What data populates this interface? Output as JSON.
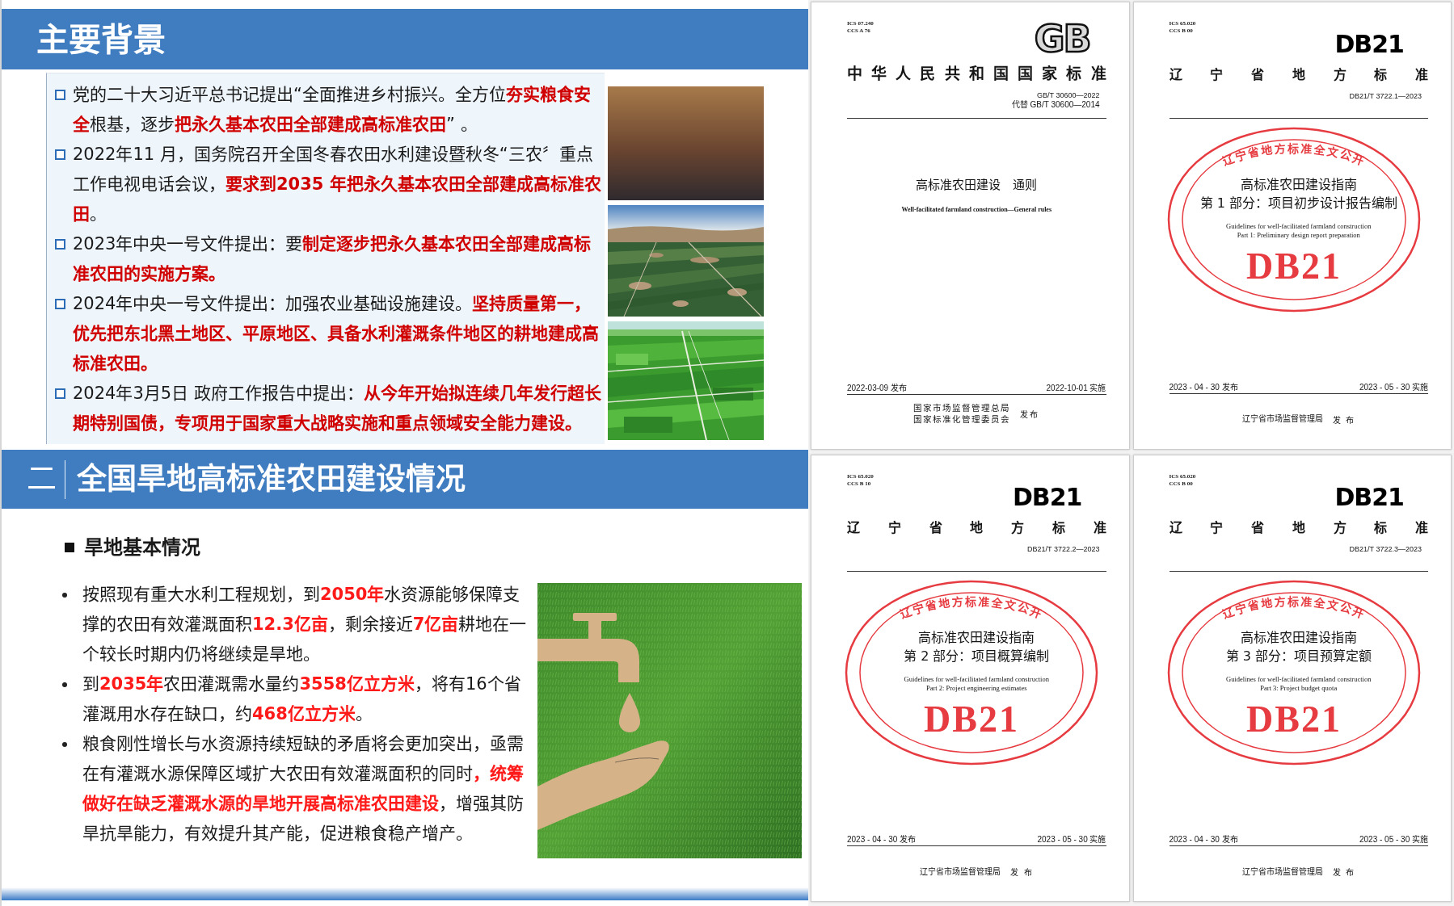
{
  "slides": [
    {
      "kind": "background",
      "title": "主要背景",
      "bullets": [
        "党的二十大习近平总书记提出“全面推进乡村振兴。全方位**夯实粮食安全**根基，逐步**把永久基本农田全部建成高标准农田**” 。",
        "2022年11 月，国务院召开全国冬春农田水利建设暨秋冬“三农〞重点工作电视电话会议，**要求到2035 年把永久基本农田全部建成高标准农田**。",
        "2023年中央一号文件提出：要**制定逐步把永久基本农田全部建成高标准农田的实施方案。**",
        "2024年中央一号文件提出：加强农业基础设施建设。**坚持质量第一，优先把东北黑土地区、平原地区、具备水利灌溉条件地区的耕地建成高标准农田。**",
        "2024年3月5日 政府工作报告中提出：**从今年开始拟连续几年发行超长期特别国债，专项用于国家重大战略实施和重点领域安全能力建设。**"
      ]
    },
    {
      "kind": "dryland",
      "section_number": "二",
      "title": "全国旱地高标准农田建设情况",
      "subheading": "旱地基本情况",
      "bullets": [
        "按照现有重大水利工程规划，到**2050年**水资源能够保障支撑的农田有效灌溉面积**12.3亿亩**，剩余接近**7亿亩**耕地在一个较长时期内仍将继续是旱地。",
        "到**2035年**农田灌溉需水量约**3558亿立方米**，将有16个省灌溉用水存在缺口，约**468亿立方米**。",
        "粮食刚性增长与水资源持续短缺的矛盾将会更加突出，亟需在有灌溉水源保障区域扩大农田有效灌溉面积的同时**，统筹做好在缺乏灌溉水源的旱地开展高标准农田建设**，增强其防旱抗旱能力，有效提升其产能，促进粮食稳产增产。"
      ]
    }
  ],
  "documents": [
    {
      "kind": "national",
      "ics": "ICS 07.240",
      "ccs": "CCS A 76",
      "logo": "GB",
      "issuer_title": "中华人民共和国国家标准",
      "code": "GB/T 30600—2022",
      "replaces": "代替 GB/T 30600—2014",
      "title_lines": [
        "高标准农田建设　通则"
      ],
      "english_lines": [
        "Well-facilitated farmland construction—General rules"
      ],
      "issue_date": "2022-03-09 发布",
      "effective_date": "2022-10-01 实施",
      "issuers": [
        "国家市场监督管理总局",
        "国家标准化管理委员会"
      ],
      "issue_label": "发布"
    },
    {
      "kind": "local",
      "ics": "ICS 65.020",
      "ccs": "CCS B 00",
      "logo": "DB21",
      "issuer_title": "辽宁省地方标准",
      "code": "DB21/T 3722.1—2023",
      "seal": {
        "text": "辽宁省地方标准全文公开",
        "code": "DB21"
      },
      "title_lines": [
        "高标准农田建设指南",
        "第 1 部分：项目初步设计报告编制"
      ],
      "english_lines": [
        "Guidelines for well-facilitated farmland construction",
        "Part 1: Preliminary design report preparation"
      ],
      "issue_date": "2023 - 04 - 30 发布",
      "effective_date": "2023 - 05 - 30 实施",
      "issuers": [
        "辽宁省市场监督管理局"
      ],
      "issue_label": "发 布"
    },
    {
      "kind": "local",
      "ics": "ICS 65.020",
      "ccs": "CCS B 10",
      "logo": "DB21",
      "issuer_title": "辽宁省地方标准",
      "code": "DB21/T 3722.2—2023",
      "seal": {
        "text": "辽宁省地方标准全文公开",
        "code": "DB21"
      },
      "title_lines": [
        "高标准农田建设指南",
        "第 2 部分：项目概算编制"
      ],
      "english_lines": [
        "Guidelines for well-facilitated farmland construction",
        "Part 2: Project engineering estimates"
      ],
      "issue_date": "2023 - 04 - 30 发布",
      "effective_date": "2023 - 05 - 30 实施",
      "issuers": [
        "辽宁省市场监督管理局"
      ],
      "issue_label": "发 布"
    },
    {
      "kind": "local",
      "ics": "ICS 65.020",
      "ccs": "CCS B 00",
      "logo": "DB21",
      "issuer_title": "辽宁省地方标准",
      "code": "DB21/T 3722.3—2023",
      "seal": {
        "text": "辽宁省地方标准全文公开",
        "code": "DB21"
      },
      "title_lines": [
        "高标准农田建设指南",
        "第 3 部分：项目预算定额"
      ],
      "english_lines": [
        "Guidelines for well-facilitated farmland construction",
        "Part 3: Project budget quota"
      ],
      "issue_date": "2023 - 04 - 30 发布",
      "effective_date": "2023 - 05 - 30 实施",
      "issuers": [
        "辽宁省市场监督管理局"
      ],
      "issue_label": "发 布"
    }
  ]
}
